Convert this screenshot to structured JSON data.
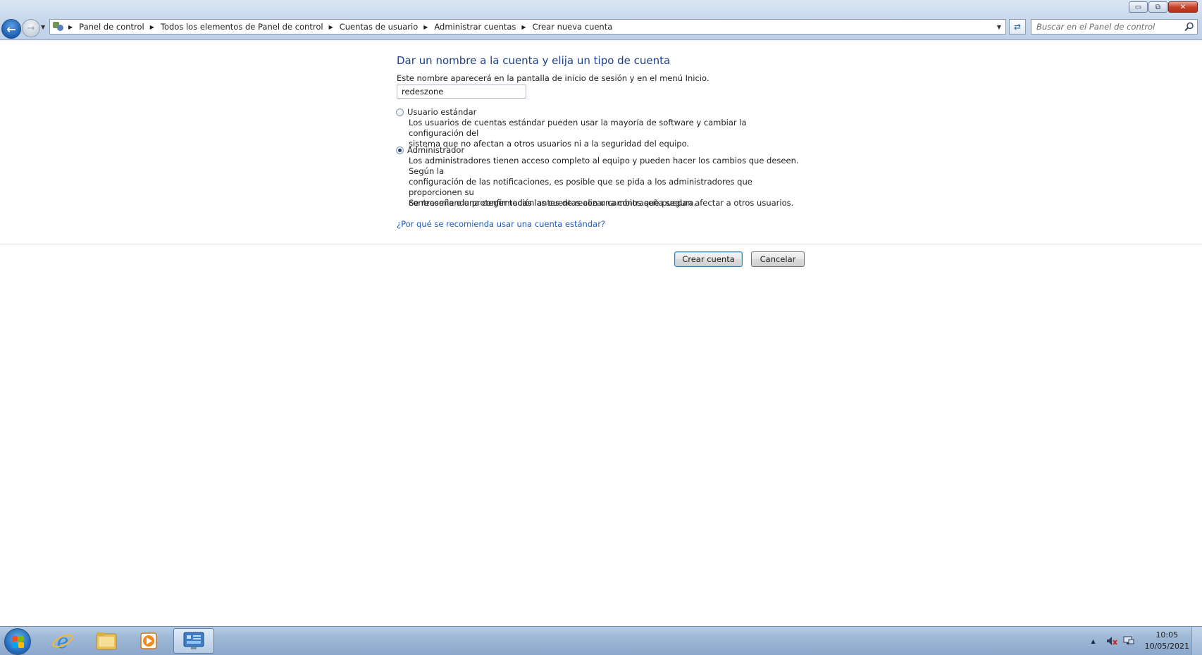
{
  "window": {
    "minimize_symbol": "▭",
    "maximize_symbol": "⧉",
    "close_symbol": "✕"
  },
  "navigation": {
    "back_icon": "arrow-left-icon",
    "forward_icon": "arrow-right-icon"
  },
  "breadcrumb": [
    {
      "label": "Panel de control"
    },
    {
      "label": "Todos los elementos de Panel de control"
    },
    {
      "label": "Cuentas de usuario"
    },
    {
      "label": "Administrar cuentas"
    },
    {
      "label": "Crear nueva cuenta"
    }
  ],
  "search": {
    "placeholder": "Buscar en el Panel de control"
  },
  "main": {
    "heading": "Dar un nombre a la cuenta y elija un tipo de cuenta",
    "subtitle": "Este nombre aparecerá en la pantalla de inicio de sesión y en el menú Inicio.",
    "account_name_value": "redeszone",
    "options": {
      "standard": {
        "label": "Usuario estándar",
        "checked": false,
        "description_1": "Los usuarios de cuentas estándar pueden usar la mayoría de software y cambiar la configuración del",
        "description_2": "sistema que no afectan a otros usuarios ni a la seguridad del equipo."
      },
      "admin": {
        "label": "Administrador",
        "checked": true,
        "description_1": "Los administradores tienen acceso completo al equipo y pueden hacer los cambios que deseen. Según la",
        "description_2": "configuración de las notificaciones, es posible que se pida a los administradores que proporcionen su",
        "description_3": "contraseña o una confirmación antes de realizar cambios que puedan afectar a otros usuarios."
      }
    },
    "recommendation": "Se recomienda proteger todas las cuentas con una contraseña segura.",
    "help_link": "¿Por qué se recomienda usar una cuenta estándar?",
    "create_button": "Crear cuenta",
    "cancel_button": "Cancelar"
  },
  "taskbar": {
    "pinned": [
      "start-orb",
      "internet-explorer-icon",
      "file-explorer-icon",
      "media-player-icon",
      "control-panel-icon"
    ],
    "tray": {
      "time": "10:05",
      "date": "10/05/2021",
      "overflow_symbol": "▲"
    }
  }
}
